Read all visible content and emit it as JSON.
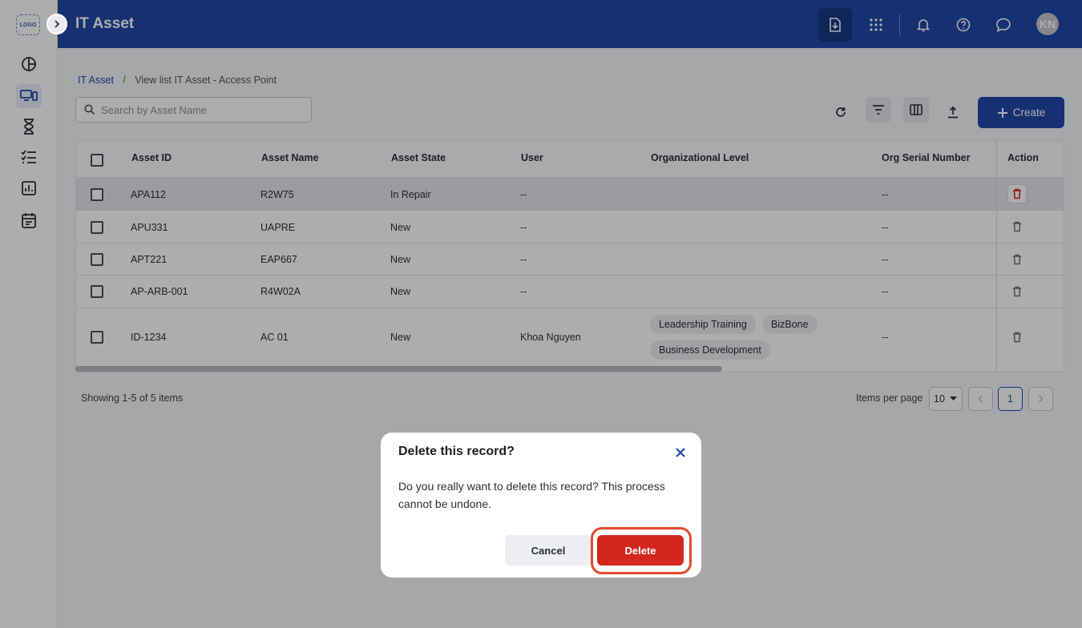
{
  "app": {
    "logo_text": "LOGO",
    "title": "IT Asset",
    "user_initials": "KN"
  },
  "breadcrumb": {
    "root": "IT Asset",
    "separator": "/",
    "current": "View list IT Asset - Access Point"
  },
  "search": {
    "placeholder": "Search by Asset Name",
    "value": ""
  },
  "toolbar": {
    "create_label": "Create"
  },
  "table": {
    "columns": [
      "Asset ID",
      "Asset Name",
      "Asset State",
      "User",
      "Organizational Level",
      "Org Serial Number",
      "Action"
    ],
    "rows": [
      {
        "asset_id": "APA112",
        "asset_name": "R2W75",
        "asset_state": "In Repair",
        "user": "--",
        "org_levels": [],
        "org_serial": "--"
      },
      {
        "asset_id": "APU331",
        "asset_name": "UAPRE",
        "asset_state": "New",
        "user": "--",
        "org_levels": [],
        "org_serial": "--"
      },
      {
        "asset_id": "APT221",
        "asset_name": "EAP667",
        "asset_state": "New",
        "user": "--",
        "org_levels": [],
        "org_serial": "--"
      },
      {
        "asset_id": "AP-ARB-001",
        "asset_name": "R4W02A",
        "asset_state": "New",
        "user": "--",
        "org_levels": [],
        "org_serial": "--"
      },
      {
        "asset_id": "ID-1234",
        "asset_name": "AC 01",
        "asset_state": "New",
        "user": "Khoa Nguyen",
        "org_levels": [
          "Leadership Training",
          "BizBone",
          "Business Development"
        ],
        "org_serial": "--"
      }
    ]
  },
  "footer": {
    "showing": "Showing 1-5 of 5 items",
    "items_per_page_label": "Items per page",
    "items_per_page_value": "10",
    "current_page": "1"
  },
  "modal": {
    "title": "Delete this record?",
    "body": "Do you really want to delete this record? This process cannot be undone.",
    "cancel_label": "Cancel",
    "delete_label": "Delete"
  },
  "colors": {
    "brand": "#1f49a8",
    "danger": "#d3261f",
    "highlight": "#e24a2f"
  },
  "icons": {
    "sidebar": [
      "dashboard-icon",
      "devices-icon",
      "hourglass-icon",
      "checklist-icon",
      "report-icon",
      "calendar-icon"
    ],
    "header": [
      "download-icon",
      "apps-grid-icon",
      "bell-icon",
      "help-icon",
      "chat-icon"
    ],
    "toolbar": [
      "refresh-icon",
      "filter-icon",
      "columns-icon",
      "export-icon"
    ]
  }
}
